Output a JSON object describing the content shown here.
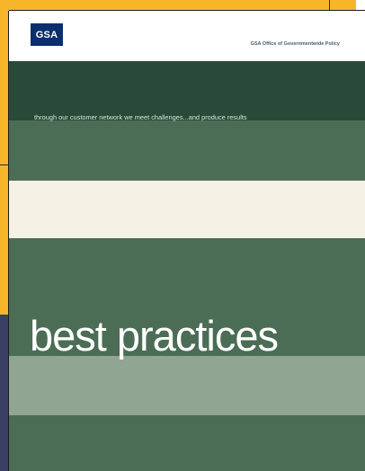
{
  "cover": {
    "logo_text": "GSA",
    "office": "GSA Office of Governmentwide Policy",
    "tagline": "through our customer network we meet challenges...and produce results",
    "title": "best practices"
  },
  "colors": {
    "background_gold": "#f7b62a",
    "background_navy": "#3b3f63",
    "logo_blue": "#0a2e6e",
    "dark_green": "#2a4a39",
    "green": "#4b6d56",
    "cream": "#f5f2e5",
    "sage": "#91a593"
  }
}
